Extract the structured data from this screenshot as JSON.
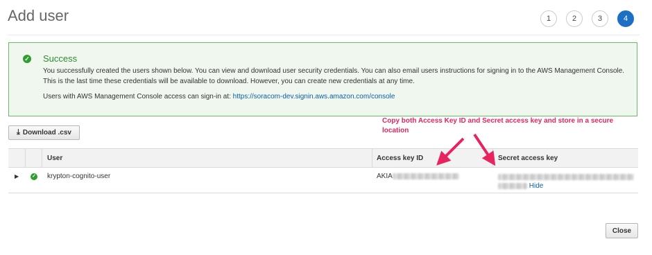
{
  "header": {
    "title": "Add user",
    "steps": [
      "1",
      "2",
      "3",
      "4"
    ],
    "active_step": "4"
  },
  "success": {
    "title": "Success",
    "message_line1": "You successfully created the users shown below. You can view and download user security credentials. You can also email users instructions for signing in to the AWS Management Console.",
    "message_line2": "This is the last time these credentials will be available to download. However, you can create new credentials at any time.",
    "console_prefix": "Users with AWS Management Console access can sign-in at: ",
    "console_url": "https://soracom-dev.signin.aws.amazon.com/console"
  },
  "toolbar": {
    "download_label": "Download .csv"
  },
  "annotation": {
    "text": "Copy both Access Key ID and Secret access key and store in a secure location"
  },
  "table": {
    "columns": [
      "User",
      "Access key ID",
      "Secret access key"
    ],
    "rows": [
      {
        "user": "krypton-cognito-user",
        "access_key_prefix": "AKIA",
        "secret_action": "Hide"
      }
    ]
  },
  "footer": {
    "close_label": "Close"
  },
  "colors": {
    "accent": "#1c6fc4",
    "success": "#2e9e2e",
    "annotation": "#e8235d",
    "link": "#0b5fa5"
  }
}
